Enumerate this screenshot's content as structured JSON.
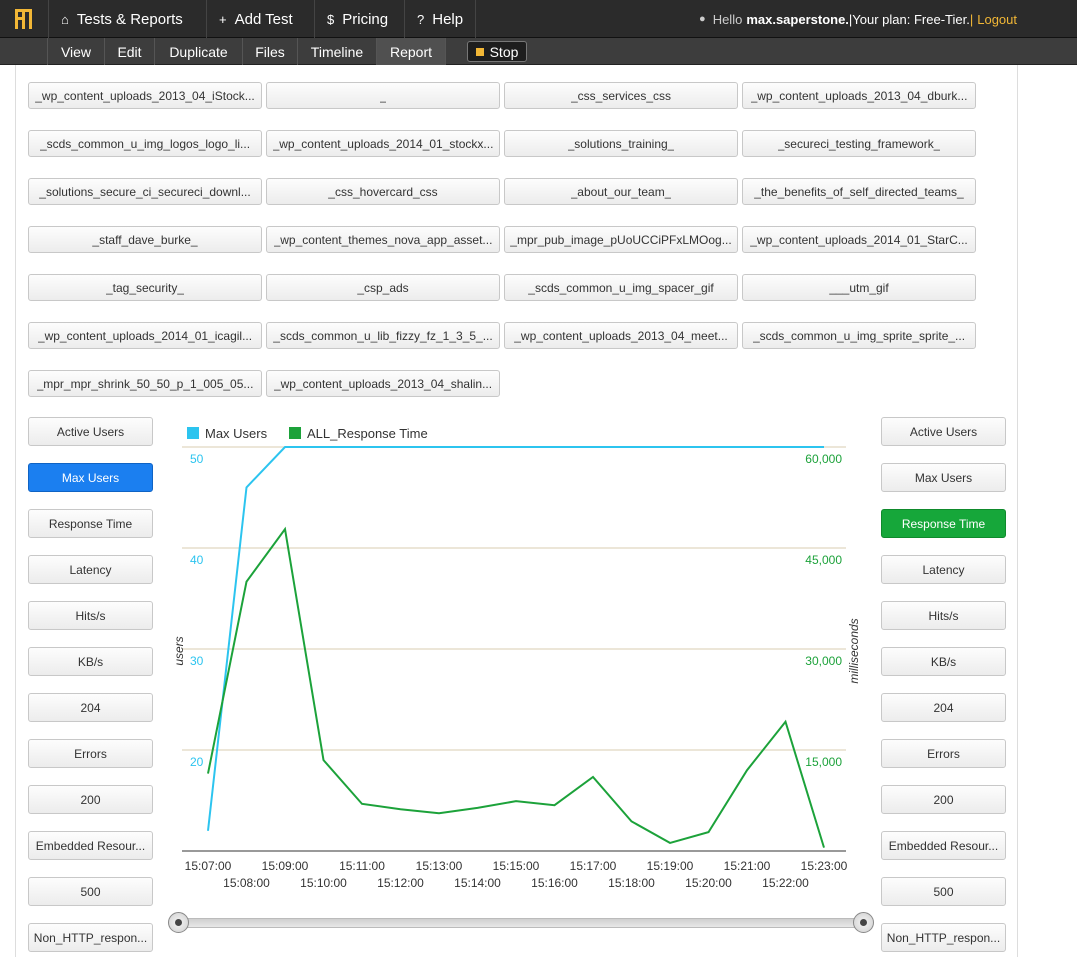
{
  "topnav": {
    "items": [
      {
        "icon": "home-icon",
        "glyph": "⌂",
        "label": "Tests & Reports"
      },
      {
        "icon": "plus-icon",
        "glyph": "+",
        "label": "Add Test"
      },
      {
        "icon": "dollar-icon",
        "glyph": "$",
        "label": "Pricing"
      },
      {
        "icon": "help-icon",
        "glyph": "?",
        "label": "Help"
      }
    ],
    "hello": "Hello",
    "username": "max.saperstone.",
    "plan": "|Your plan: Free-Tier.",
    "sep": "|",
    "logout": "Logout"
  },
  "subnav": {
    "items": [
      "View",
      "Edit",
      "Duplicate",
      "Files",
      "Timeline",
      "Report"
    ],
    "active": "Report",
    "stop": "Stop"
  },
  "labels": [
    "_wp_content_uploads_2013_04_iStock...",
    "_",
    "_css_services_css",
    "_wp_content_uploads_2013_04_dburk...",
    "_scds_common_u_img_logos_logo_li...",
    "_wp_content_uploads_2014_01_stockx...",
    "_solutions_training_",
    "_secureci_testing_framework_",
    "_solutions_secure_ci_secureci_downl...",
    "_css_hovercard_css",
    "_about_our_team_",
    "_the_benefits_of_self_directed_teams_",
    "_staff_dave_burke_",
    "_wp_content_themes_nova_app_asset...",
    "_mpr_pub_image_pUoUCCiPFxLMOog...",
    "_wp_content_uploads_2014_01_StarC...",
    "_tag_security_",
    "_csp_ads",
    "_scds_common_u_img_spacer_gif",
    "___utm_gif",
    "_wp_content_uploads_2014_01_icagil...",
    "_scds_common_u_lib_fizzy_fz_1_3_5_...",
    "_wp_content_uploads_2013_04_meet...",
    "_scds_common_u_img_sprite_sprite_...",
    "_mpr_mpr_shrink_50_50_p_1_005_05...",
    "_wp_content_uploads_2013_04_shalin..."
  ],
  "series_buttons": [
    "Active Users",
    "Max Users",
    "Response Time",
    "Latency",
    "Hits/s",
    "KB/s",
    "204",
    "Errors",
    "200",
    "Embedded Resour...",
    "500",
    "Non_HTTP_respon..."
  ],
  "left_selected": "Max Users",
  "right_selected": "Response Time",
  "colors": {
    "max_users": "#2cc4ef",
    "response_time": "#1ca23a",
    "blue_button": "#1b7ff0",
    "green_button": "#16a73a",
    "grid": "#d9cdb0"
  },
  "chart_data": {
    "type": "line",
    "legend": "top-left",
    "x": [
      "15:07:00",
      "15:08:00",
      "15:09:00",
      "15:10:00",
      "15:11:00",
      "15:12:00",
      "15:13:00",
      "15:14:00",
      "15:15:00",
      "15:16:00",
      "15:17:00",
      "15:18:00",
      "15:19:00",
      "15:20:00",
      "15:21:00",
      "15:22:00",
      "15:23:00"
    ],
    "series": [
      {
        "name": "Max Users",
        "axis": "left",
        "values": [
          12,
          46,
          50,
          50,
          50,
          50,
          50,
          50,
          50,
          50,
          50,
          50,
          50,
          50,
          50,
          50,
          50
        ]
      },
      {
        "name": "ALL_Response Time",
        "axis": "right",
        "values": [
          11500,
          40000,
          47800,
          13500,
          7000,
          6200,
          5600,
          6400,
          7400,
          6800,
          11000,
          4400,
          1200,
          2800,
          12000,
          19200,
          500
        ]
      }
    ],
    "left_axis": {
      "label": "users",
      "ticks": [
        20,
        30,
        40,
        50
      ],
      "range": [
        10,
        50
      ]
    },
    "right_axis": {
      "label": "milliseconds",
      "ticks": [
        "15,000",
        "30,000",
        "45,000",
        "60,000"
      ],
      "tick_values": [
        15000,
        30000,
        45000,
        60000
      ],
      "range": [
        0,
        60000
      ]
    },
    "grid": true
  }
}
